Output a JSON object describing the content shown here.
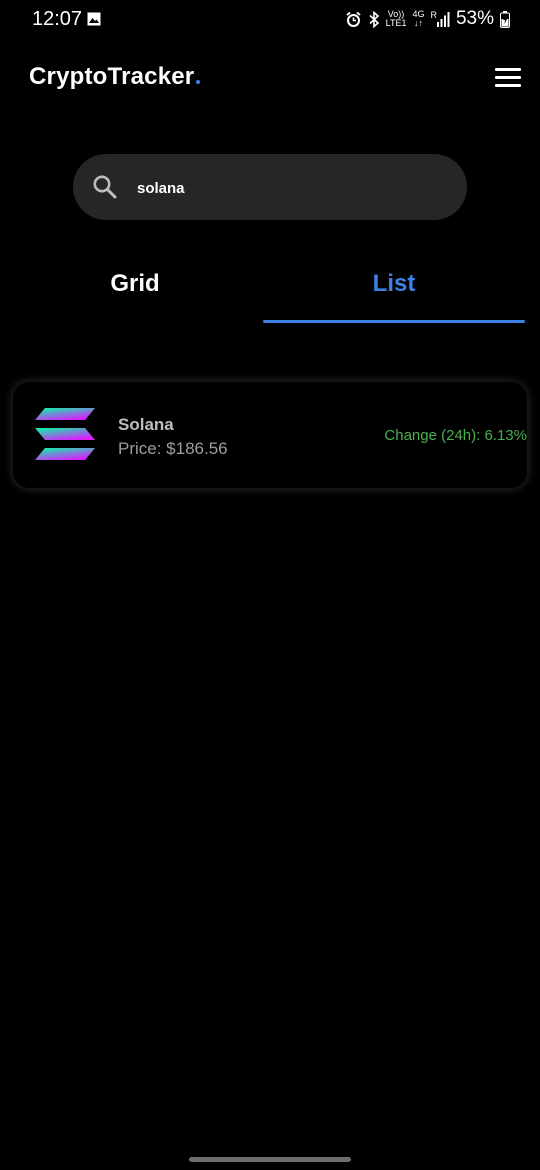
{
  "status_bar": {
    "time": "12:07",
    "volte_top": "Vo))",
    "volte_bottom": "LTE1",
    "network_top": "4G",
    "network_bottom": "↓↑",
    "roaming": "R",
    "battery": "53%"
  },
  "header": {
    "title": "CryptoTracker",
    "accent_color": "#3f82e6"
  },
  "search": {
    "value": "solana",
    "placeholder": ""
  },
  "tabs": [
    {
      "label": "Grid",
      "active": false
    },
    {
      "label": "List",
      "active": true
    }
  ],
  "coins": [
    {
      "name": "Solana",
      "price": "Price: $186.56",
      "change": "Change (24h): 6.13%",
      "change_color": "#4caf50",
      "icon": "solana-logo-icon"
    }
  ]
}
